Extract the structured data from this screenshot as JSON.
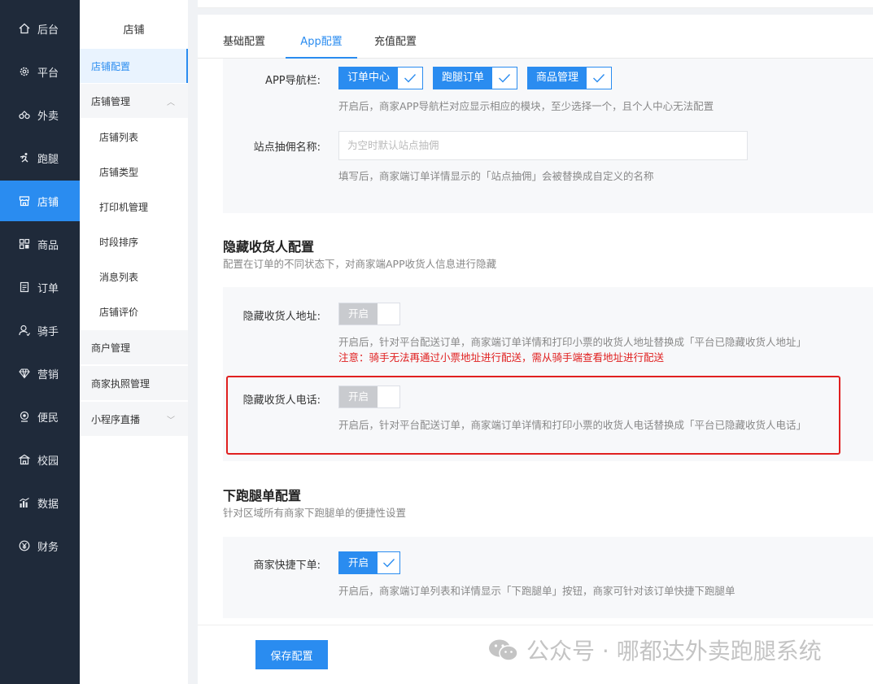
{
  "sidebar": {
    "items": [
      {
        "label": "后台",
        "icon": "home-icon"
      },
      {
        "label": "平台",
        "icon": "gear-icon"
      },
      {
        "label": "外卖",
        "icon": "delivery-icon"
      },
      {
        "label": "跑腿",
        "icon": "runner-icon"
      },
      {
        "label": "店铺",
        "icon": "store-icon"
      },
      {
        "label": "商品",
        "icon": "grid-icon"
      },
      {
        "label": "订单",
        "icon": "order-icon"
      },
      {
        "label": "骑手",
        "icon": "rider-icon"
      },
      {
        "label": "营销",
        "icon": "diamond-icon"
      },
      {
        "label": "便民",
        "icon": "service-icon"
      },
      {
        "label": "校园",
        "icon": "campus-icon"
      },
      {
        "label": "数据",
        "icon": "chart-icon"
      },
      {
        "label": "财务",
        "icon": "yen-icon"
      }
    ],
    "active_color": "#2a8cf0"
  },
  "subnav": {
    "title": "店铺",
    "items": [
      {
        "label": "店铺配置"
      },
      {
        "label": "店铺管理"
      },
      {
        "label": "店铺列表"
      },
      {
        "label": "店铺类型"
      },
      {
        "label": "打印机管理"
      },
      {
        "label": "时段排序"
      },
      {
        "label": "消息列表"
      },
      {
        "label": "店铺评价"
      },
      {
        "label": "商户管理"
      },
      {
        "label": "商家执照管理"
      },
      {
        "label": "小程序直播"
      }
    ]
  },
  "tabs": [
    {
      "label": "基础配置"
    },
    {
      "label": "App配置"
    },
    {
      "label": "充值配置"
    }
  ],
  "app_nav": {
    "label": "APP导航栏:",
    "options": [
      {
        "label": "订单中心"
      },
      {
        "label": "跑腿订单"
      },
      {
        "label": "商品管理"
      }
    ],
    "hint": "开启后，商家APP导航栏对应显示相应的模块，至少选择一个，且个人中心无法配置"
  },
  "site_commission": {
    "label": "站点抽佣名称:",
    "placeholder": "为空时默认站点抽佣",
    "hint": "填写后，商家端订单详情显示的「站点抽佣」会被替换成自定义的名称"
  },
  "hide_receiver": {
    "title": "隐藏收货人配置",
    "subtitle": "配置在订单的不同状态下，对商家端APP收货人信息进行隐藏",
    "address": {
      "label": "隐藏收货人地址:",
      "switch_label": "开启",
      "hint": "开启后，针对平台配送订单，商家端订单详情和打印小票的收货人地址替换成「平台已隐藏收货人地址」",
      "warning": "注意：骑手无法再通过小票地址进行配送，需从骑手端查看地址进行配送"
    },
    "phone": {
      "label": "隐藏收货人电话:",
      "switch_label": "开启",
      "hint": "开启后，针对平台配送订单，商家端订单详情和打印小票的收货人电话替换成「平台已隐藏收货人电话」"
    }
  },
  "errand": {
    "title": "下跑腿单配置",
    "subtitle": "针对区域所有商家下跑腿单的便捷性设置",
    "quick": {
      "label": "商家快捷下单:",
      "switch_label": "开启",
      "hint": "开启后，商家端订单列表和详情显示「下跑腿单」按钮，商家可针对该订单快捷下跑腿单"
    }
  },
  "footer": {
    "save_label": "保存配置",
    "watermark": "公众号 · 哪都达外卖跑腿系统"
  }
}
